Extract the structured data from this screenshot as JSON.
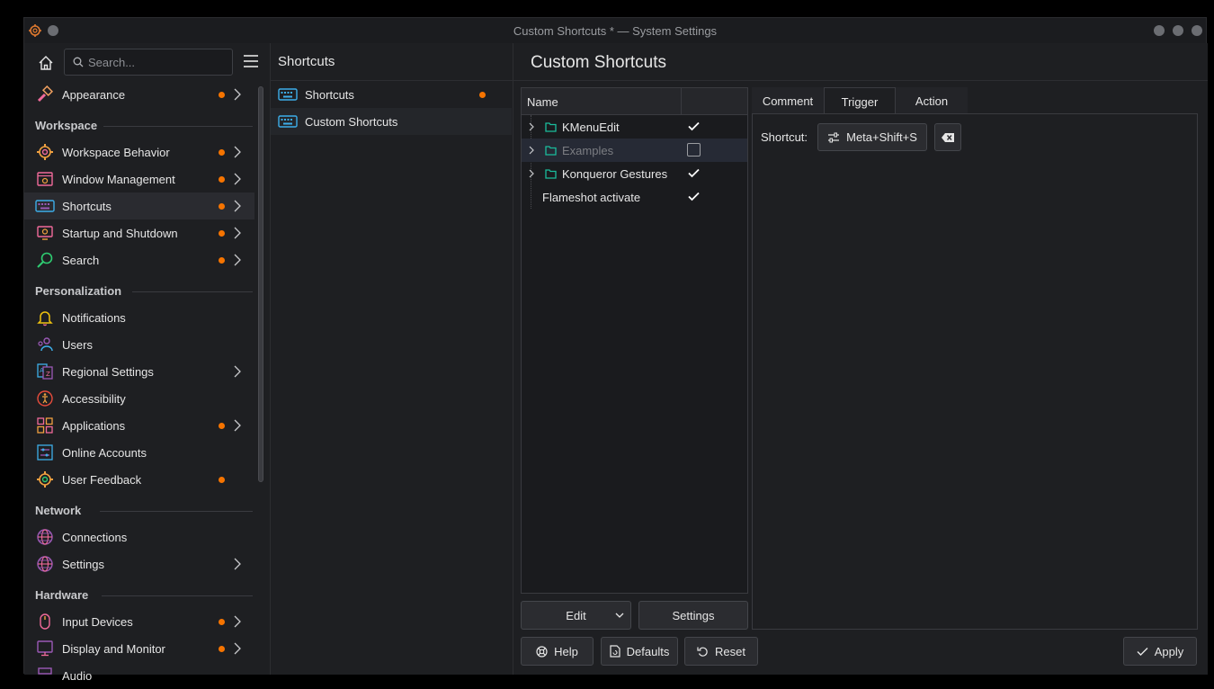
{
  "window": {
    "title": "Custom Shortcuts * — System Settings"
  },
  "search": {
    "placeholder": "Search..."
  },
  "sidebar": {
    "top_item": {
      "label": "Appearance",
      "icon": "paintbrush-icon"
    },
    "sections": [
      {
        "header": "Workspace",
        "items": [
          {
            "label": "Workspace Behavior",
            "icon": "gear-icon",
            "modified": true,
            "has_children": true
          },
          {
            "label": "Window Management",
            "icon": "window-icon",
            "modified": true,
            "has_children": true
          },
          {
            "label": "Shortcuts",
            "icon": "keyboard-icon",
            "modified": true,
            "has_children": true,
            "active": true
          },
          {
            "label": "Startup and Shutdown",
            "icon": "monitor-power-icon",
            "modified": true,
            "has_children": true
          },
          {
            "label": "Search",
            "icon": "magnifier-icon",
            "modified": true,
            "has_children": true
          }
        ]
      },
      {
        "header": "Personalization",
        "items": [
          {
            "label": "Notifications",
            "icon": "bell-icon",
            "modified": false,
            "has_children": false
          },
          {
            "label": "Users",
            "icon": "users-icon",
            "modified": false,
            "has_children": false
          },
          {
            "label": "Regional Settings",
            "icon": "language-icon",
            "modified": false,
            "has_children": true
          },
          {
            "label": "Accessibility",
            "icon": "accessibility-icon",
            "modified": false,
            "has_children": false
          },
          {
            "label": "Applications",
            "icon": "grid-icon",
            "modified": true,
            "has_children": true
          },
          {
            "label": "Online Accounts",
            "icon": "accounts-icon",
            "modified": false,
            "has_children": false
          },
          {
            "label": "User Feedback",
            "icon": "feedback-gear-icon",
            "modified": true,
            "has_children": false
          }
        ]
      },
      {
        "header": "Network",
        "items": [
          {
            "label": "Connections",
            "icon": "globe-icon",
            "modified": false,
            "has_children": false
          },
          {
            "label": "Settings",
            "icon": "globe-icon",
            "modified": false,
            "has_children": true
          }
        ]
      },
      {
        "header": "Hardware",
        "items": [
          {
            "label": "Input Devices",
            "icon": "mouse-icon",
            "modified": true,
            "has_children": true
          },
          {
            "label": "Display and Monitor",
            "icon": "display-icon",
            "modified": true,
            "has_children": true
          },
          {
            "label": "Audio",
            "icon": "audio-icon",
            "modified": false,
            "has_children": false
          }
        ]
      }
    ]
  },
  "middle": {
    "title": "Shortcuts",
    "items": [
      {
        "label": "Shortcuts",
        "modified": true
      },
      {
        "label": "Custom Shortcuts",
        "modified": false
      }
    ]
  },
  "content": {
    "title": "Custom Shortcuts",
    "tree": {
      "column_name": "Name",
      "rows": [
        {
          "label": "KMenuEdit",
          "folder": true,
          "enabled": true
        },
        {
          "label": "Examples",
          "folder": true,
          "enabled": false
        },
        {
          "label": "Konqueror Gestures",
          "folder": true,
          "enabled": true
        },
        {
          "label": "Flameshot activate",
          "folder": false,
          "enabled": true
        }
      ]
    },
    "edit_label": "Edit",
    "settings_label": "Settings",
    "tabs": [
      "Comment",
      "Trigger",
      "Action"
    ],
    "selected_tab": "Trigger",
    "shortcut_label": "Shortcut:",
    "shortcut_value": "Meta+Shift+S"
  },
  "footer": {
    "help_label": "Help",
    "defaults_label": "Defaults",
    "reset_label": "Reset",
    "apply_label": "Apply"
  },
  "colors": {
    "accent_modified": "#f67400",
    "folder_teal": "#1abc9c",
    "window_bg": "#1e1f22"
  }
}
